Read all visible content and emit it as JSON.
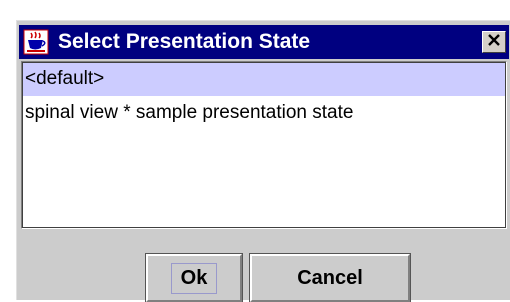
{
  "window": {
    "title": "Select Presentation State",
    "title_bar_color": "#000080",
    "app_icon": "java-cup-icon",
    "close_icon": "close-icon"
  },
  "list": {
    "selection_color": "#ccccff",
    "items": [
      {
        "label": "<default>",
        "selected": true
      },
      {
        "label": "spinal view * sample presentation state",
        "selected": false
      }
    ]
  },
  "buttons": {
    "ok_label": "Ok",
    "cancel_label": "Cancel"
  }
}
